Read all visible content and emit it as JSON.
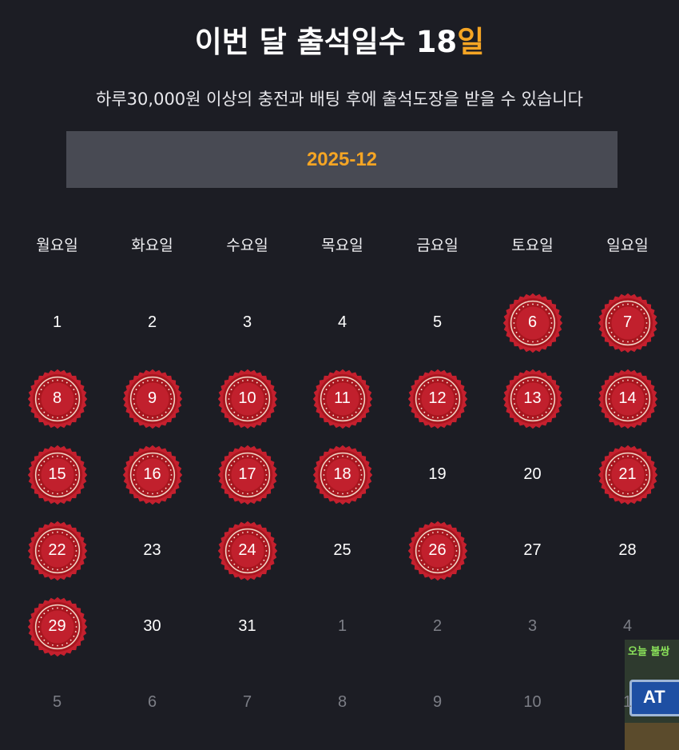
{
  "header": {
    "title_prefix": "이번 달 출석일수 ",
    "title_count": "18",
    "title_unit": "일",
    "subtitle": "하루30,000원 이상의 충전과 배팅 후에 출석도장을 받을 수 있습니다"
  },
  "calendar": {
    "month_label": "2025-12",
    "weekdays": [
      "월요일",
      "화요일",
      "수요일",
      "목요일",
      "금요일",
      "토요일",
      "일요일"
    ],
    "stamp_color": "#c4202e",
    "days": [
      {
        "label": "1",
        "current": true,
        "stamped": false
      },
      {
        "label": "2",
        "current": true,
        "stamped": false
      },
      {
        "label": "3",
        "current": true,
        "stamped": false
      },
      {
        "label": "4",
        "current": true,
        "stamped": false
      },
      {
        "label": "5",
        "current": true,
        "stamped": false
      },
      {
        "label": "6",
        "current": true,
        "stamped": true
      },
      {
        "label": "7",
        "current": true,
        "stamped": true
      },
      {
        "label": "8",
        "current": true,
        "stamped": true
      },
      {
        "label": "9",
        "current": true,
        "stamped": true
      },
      {
        "label": "10",
        "current": true,
        "stamped": true
      },
      {
        "label": "11",
        "current": true,
        "stamped": true
      },
      {
        "label": "12",
        "current": true,
        "stamped": true
      },
      {
        "label": "13",
        "current": true,
        "stamped": true
      },
      {
        "label": "14",
        "current": true,
        "stamped": true
      },
      {
        "label": "15",
        "current": true,
        "stamped": true
      },
      {
        "label": "16",
        "current": true,
        "stamped": true
      },
      {
        "label": "17",
        "current": true,
        "stamped": true
      },
      {
        "label": "18",
        "current": true,
        "stamped": true
      },
      {
        "label": "19",
        "current": true,
        "stamped": false
      },
      {
        "label": "20",
        "current": true,
        "stamped": false
      },
      {
        "label": "21",
        "current": true,
        "stamped": true
      },
      {
        "label": "22",
        "current": true,
        "stamped": true
      },
      {
        "label": "23",
        "current": true,
        "stamped": false
      },
      {
        "label": "24",
        "current": true,
        "stamped": true
      },
      {
        "label": "25",
        "current": true,
        "stamped": false
      },
      {
        "label": "26",
        "current": true,
        "stamped": true
      },
      {
        "label": "27",
        "current": true,
        "stamped": false
      },
      {
        "label": "28",
        "current": true,
        "stamped": false
      },
      {
        "label": "29",
        "current": true,
        "stamped": true
      },
      {
        "label": "30",
        "current": true,
        "stamped": false
      },
      {
        "label": "31",
        "current": true,
        "stamped": false
      },
      {
        "label": "1",
        "current": false,
        "stamped": false
      },
      {
        "label": "2",
        "current": false,
        "stamped": false
      },
      {
        "label": "3",
        "current": false,
        "stamped": false
      },
      {
        "label": "4",
        "current": false,
        "stamped": false
      },
      {
        "label": "5",
        "current": false,
        "stamped": false
      },
      {
        "label": "6",
        "current": false,
        "stamped": false
      },
      {
        "label": "7",
        "current": false,
        "stamped": false
      },
      {
        "label": "8",
        "current": false,
        "stamped": false
      },
      {
        "label": "9",
        "current": false,
        "stamped": false
      },
      {
        "label": "10",
        "current": false,
        "stamped": false
      },
      {
        "label": "1",
        "current": false,
        "stamped": false
      }
    ]
  },
  "overlay_ad": {
    "text": "오늘 불쌍",
    "sign_text": "AT"
  }
}
